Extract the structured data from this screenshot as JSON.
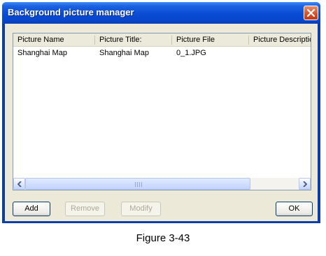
{
  "window": {
    "title": "Background picture manager",
    "icons": {
      "close": "close-icon"
    }
  },
  "list": {
    "columns": [
      "Picture Name",
      "Picture Title:",
      "Picture File",
      "Picture Description"
    ],
    "rows": [
      [
        "Shanghai Map",
        "Shanghai Map",
        "0_1.JPG",
        ""
      ]
    ]
  },
  "scrollbar": {
    "icons": {
      "left": "arrow-left-icon",
      "right": "arrow-right-icon",
      "grip": "scroll-grip-icon"
    }
  },
  "buttons": {
    "add": "Add",
    "remove": "Remove",
    "modify": "Modify",
    "ok": "OK"
  },
  "caption": "Figure 3-43",
  "colors": {
    "title_bar": "#0a4cd6",
    "close_button": "#d4502a",
    "dialog_face": "#ece9d8"
  }
}
